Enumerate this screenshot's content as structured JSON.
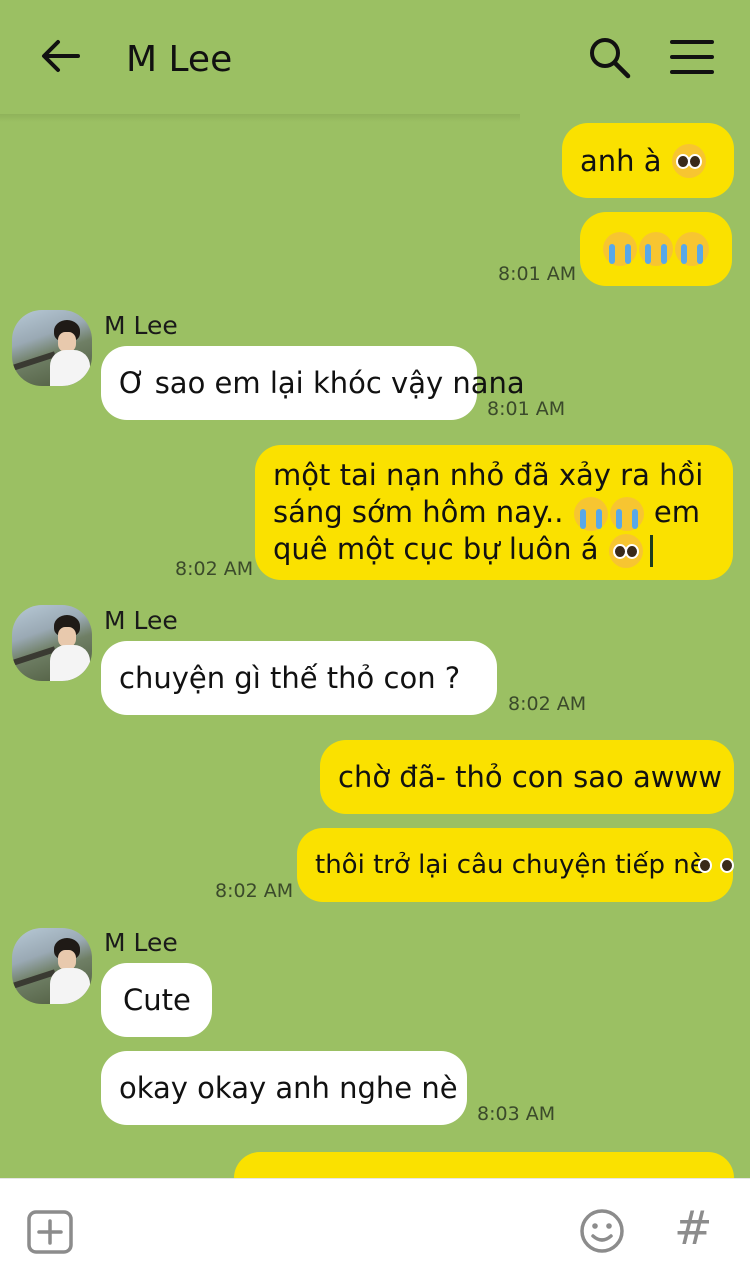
{
  "header": {
    "title": "M Lee"
  },
  "messages": {
    "m1": {
      "text": "anh à"
    },
    "m3": {
      "time": "8:01 AM"
    },
    "m4": {
      "sender": "M Lee",
      "text": "Ơ sao em lại khóc vậy nana",
      "time": "8:01 AM"
    },
    "m5": {
      "line1": "một tai nạn nhỏ đã xảy ra hồi",
      "line2a": "sáng sớm hôm nay..",
      "line2b": "em",
      "line3": "quê một cục bự luôn á",
      "time": "8:02 AM"
    },
    "m6": {
      "sender": "M Lee",
      "text": "chuyện gì thế thỏ con ?",
      "time": "8:02 AM"
    },
    "m7": {
      "text": "chờ đã- thỏ con sao awww"
    },
    "m8": {
      "text": "thôi trở lại câu chuyện tiếp nè",
      "time": "8:02 AM"
    },
    "m9": {
      "sender": "M Lee",
      "text": "Cute"
    },
    "m10": {
      "text": "okay okay anh nghe nè",
      "time": "8:03 AM"
    }
  },
  "footer": {
    "hash": "#"
  },
  "colors": {
    "chat_bg": "#9bc063",
    "my_bubble": "#fae100",
    "their_bubble": "#ffffff"
  }
}
